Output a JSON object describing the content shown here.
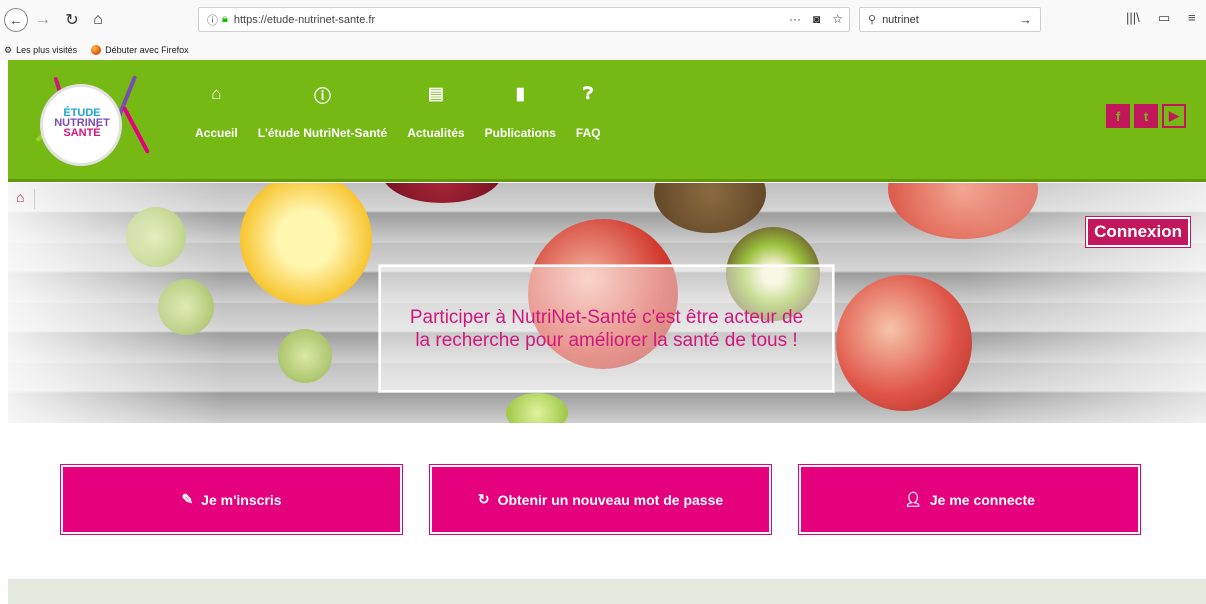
{
  "browser": {
    "url": "https://etude-nutrinet-sante.fr",
    "search_value": "nutrinet",
    "bookmarks": [
      "Les plus visités",
      "Débuter avec Firefox"
    ]
  },
  "site": {
    "logo_lines": [
      "ÉTUDE",
      "NUTRINET",
      "SANTÉ"
    ],
    "nav": [
      {
        "label": "Accueil",
        "icon": "home-icon"
      },
      {
        "label": "L'étude NutriNet-Santé",
        "icon": "info-icon"
      },
      {
        "label": "Actualités",
        "icon": "news-icon"
      },
      {
        "label": "Publications",
        "icon": "book-icon"
      },
      {
        "label": "FAQ",
        "icon": "question-icon"
      }
    ],
    "social": [
      "f",
      "t",
      "▶"
    ],
    "colors": {
      "brand_green": "#76b814",
      "brand_pink": "#e5007e"
    }
  },
  "hero": {
    "connexion_label": "Connexion",
    "tagline": "Participer à NutriNet-Santé c'est être acteur de la recherche pour améliorer la santé de tous !"
  },
  "actions": [
    {
      "label": "Je m'inscris",
      "icon": "edit-icon"
    },
    {
      "label": "Obtenir un nouveau mot de passe",
      "icon": "refresh-icon"
    },
    {
      "label": "Je me connecte",
      "icon": "user-icon"
    }
  ]
}
